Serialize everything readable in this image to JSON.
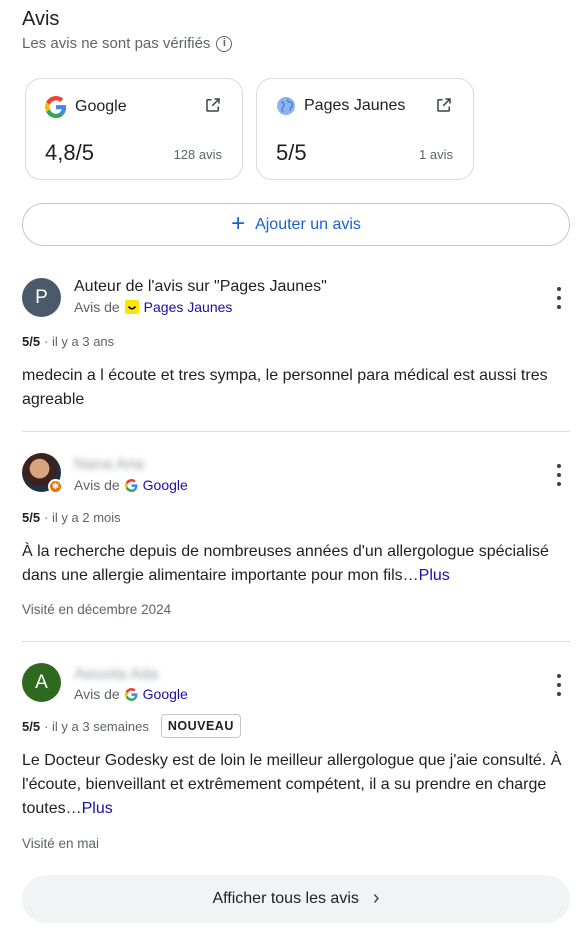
{
  "header": {
    "title": "Avis",
    "subtitle": "Les avis ne sont pas vérifiés",
    "info_icon": "info-icon"
  },
  "sources": [
    {
      "name": "Google",
      "score": "4,8/5",
      "count": "128 avis",
      "icon": "google-icon"
    },
    {
      "name": "Pages Jaunes",
      "score": "5/5",
      "count": "1 avis",
      "icon": "pages-jaunes-globe-icon"
    }
  ],
  "add_review": {
    "label": "Ajouter un avis",
    "icon": "plus-icon"
  },
  "reviews": [
    {
      "avatar_letter": "P",
      "avatar_color": "#4a5a6a",
      "author": "Auteur de l'avis sur \"Pages Jaunes\"",
      "source_prefix": "Avis de",
      "source_name": "Pages Jaunes",
      "rating": "5/5",
      "time": "· il y a 3 ans",
      "text": "medecin a l écoute et tres sympa, le personnel para médical est aussi tres agreable"
    },
    {
      "avatar_letter": "",
      "author": "Nana Aria",
      "source_prefix": "Avis de",
      "source_name": "Google",
      "rating": "5/5",
      "time": "· il y a 2 mois",
      "text": "À la recherche depuis de nombreuses années d'un allergologue spécialisé dans une allergie alimentaire importante pour mon fils…",
      "more": "Plus",
      "visited": "Visité en décembre 2024"
    },
    {
      "avatar_letter": "A",
      "avatar_color": "#2d6a1f",
      "author": "Awuola Ada",
      "source_prefix": "Avis de",
      "source_name": "Google",
      "rating": "5/5",
      "time": "· il y a 3 semaines",
      "badge": "NOUVEAU",
      "text": "Le Docteur Godesky est de loin le meilleur allergologue que j'aie consulté. À l'écoute, bienveillant et extrêmement compétent, il a su prendre en charge toutes…",
      "more": "Plus",
      "visited": "Visité en mai"
    }
  ],
  "show_all": {
    "label": "Afficher tous les avis",
    "icon": "chevron-right-icon"
  },
  "colors": {
    "link": "#1a0dab",
    "accent": "#1a61d0",
    "divider": "#dadce0"
  }
}
